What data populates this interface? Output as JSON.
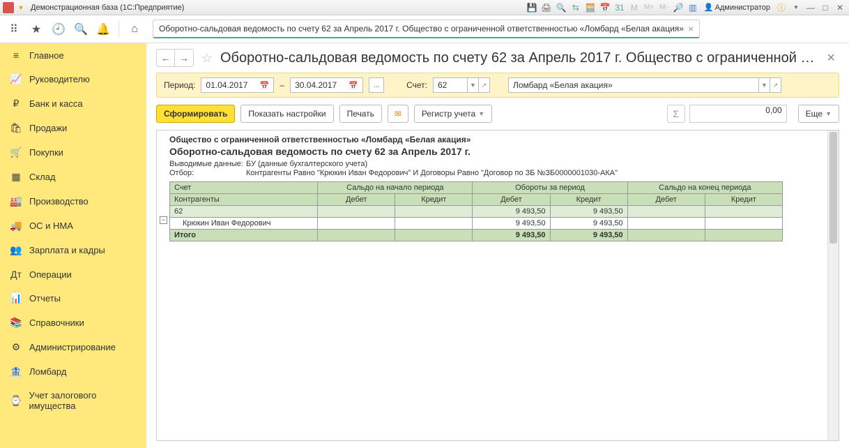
{
  "titleBar": {
    "appTitle": "Демонстрационная база  (1С:Предприятие)",
    "adminLabel": "Администратор"
  },
  "openTab": {
    "label": "Оборотно-сальдовая ведомость по счету 62 за Апрель 2017 г. Общество с ограниченной ответственностью «Ломбард «Белая акация»"
  },
  "sidebar": {
    "items": [
      {
        "icon": "≡",
        "label": "Главное"
      },
      {
        "icon": "📈",
        "label": "Руководителю"
      },
      {
        "icon": "₽",
        "label": "Банк и касса"
      },
      {
        "icon": "🛍",
        "label": "Продажи"
      },
      {
        "icon": "🛒",
        "label": "Покупки"
      },
      {
        "icon": "▦",
        "label": "Склад"
      },
      {
        "icon": "🏭",
        "label": "Производство"
      },
      {
        "icon": "🚚",
        "label": "ОС и НМА"
      },
      {
        "icon": "👥",
        "label": "Зарплата и кадры"
      },
      {
        "icon": "Дт",
        "label": "Операции"
      },
      {
        "icon": "📊",
        "label": "Отчеты"
      },
      {
        "icon": "📚",
        "label": "Справочники"
      },
      {
        "icon": "⚙",
        "label": "Администрирование"
      },
      {
        "icon": "🏦",
        "label": "Ломбард"
      },
      {
        "icon": "⌚",
        "label": "Учет залогового имущества"
      }
    ]
  },
  "doc": {
    "title": "Оборотно-сальдовая ведомость по счету 62 за Апрель 2017 г. Общество с ограниченной от..."
  },
  "params": {
    "periodLabel": "Период:",
    "dateFrom": "01.04.2017",
    "dateTo": "30.04.2017",
    "dash": "–",
    "accountLabel": "Счет:",
    "accountValue": "62",
    "orgValue": "Ломбард «Белая акация»"
  },
  "actions": {
    "generate": "Сформировать",
    "showSettings": "Показать настройки",
    "print": "Печать",
    "register": "Регистр учета",
    "sumValue": "0,00",
    "more": "Еще"
  },
  "report": {
    "org": "Общество с ограниченной ответственностью «Ломбард «Белая акация»",
    "title": "Оборотно-сальдовая ведомость по счету 62 за Апрель 2017 г.",
    "outputLabel": "Выводимые данные:",
    "outputValue": "БУ (данные бухгалтерского учета)",
    "filterLabel": "Отбор:",
    "filterValue": "Контрагенты Равно \"Крюкин Иван Федорович\" И Договоры Равно \"Договор по ЗБ №ЗБ0000001030-АКА\"",
    "headers": {
      "acct": "Счет",
      "contr": "Контрагенты",
      "startBal": "Сальдо на начало периода",
      "turnover": "Обороты за период",
      "endBal": "Сальдо на конец периода",
      "debit": "Дебет",
      "credit": "Кредит"
    },
    "rows": [
      {
        "level": 0,
        "label": "62",
        "sd": "",
        "sc": "",
        "td": "9 493,50",
        "tc": "9 493,50",
        "ed": "",
        "ec": ""
      },
      {
        "level": 1,
        "label": "Крюкин Иван Федорович",
        "sd": "",
        "sc": "",
        "td": "9 493,50",
        "tc": "9 493,50",
        "ed": "",
        "ec": ""
      }
    ],
    "total": {
      "label": "Итого",
      "sd": "",
      "sc": "",
      "td": "9 493,50",
      "tc": "9 493,50",
      "ed": "",
      "ec": ""
    }
  }
}
